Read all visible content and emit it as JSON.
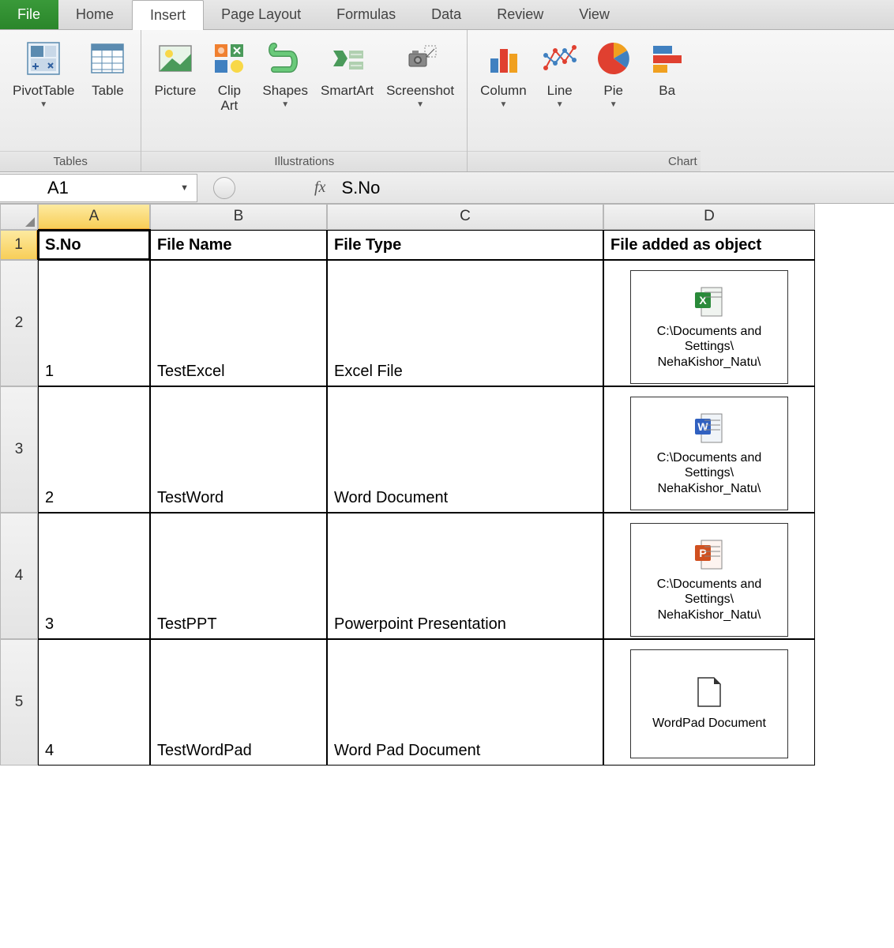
{
  "tabs": {
    "file": "File",
    "home": "Home",
    "insert": "Insert",
    "page_layout": "Page Layout",
    "formulas": "Formulas",
    "data": "Data",
    "review": "Review",
    "view": "View"
  },
  "ribbon": {
    "tables": {
      "label": "Tables",
      "pivot": "PivotTable",
      "table": "Table"
    },
    "illustrations": {
      "label": "Illustrations",
      "picture": "Picture",
      "clipart": "Clip\nArt",
      "shapes": "Shapes",
      "smartart": "SmartArt",
      "screenshot": "Screenshot"
    },
    "charts": {
      "label": "Chart",
      "column": "Column",
      "line": "Line",
      "pie": "Pie",
      "bar": "Ba"
    }
  },
  "formula_bar": {
    "name_box": "A1",
    "fx": "fx",
    "formula": "S.No"
  },
  "columns": [
    "A",
    "B",
    "C",
    "D"
  ],
  "rows": [
    "1",
    "2",
    "3",
    "4",
    "5"
  ],
  "headers": {
    "sno": "S.No",
    "filename": "File Name",
    "filetype": "File Type",
    "fileobject": "File added as object"
  },
  "data": [
    {
      "sno": "1",
      "filename": "TestExcel",
      "filetype": "Excel File",
      "obj_type": "excel",
      "obj_text": "C:\\Documents and Settings\\ NehaKishor_Natu\\"
    },
    {
      "sno": "2",
      "filename": "TestWord",
      "filetype": "Word Document",
      "obj_type": "word",
      "obj_text": "C:\\Documents and Settings\\ NehaKishor_Natu\\"
    },
    {
      "sno": "3",
      "filename": "TestPPT",
      "filetype": "Powerpoint Presentation",
      "obj_type": "ppt",
      "obj_text": "C:\\Documents and Settings\\ NehaKishor_Natu\\"
    },
    {
      "sno": "4",
      "filename": "TestWordPad",
      "filetype": "Word Pad Document",
      "obj_type": "wordpad",
      "obj_text": "WordPad Document"
    }
  ]
}
